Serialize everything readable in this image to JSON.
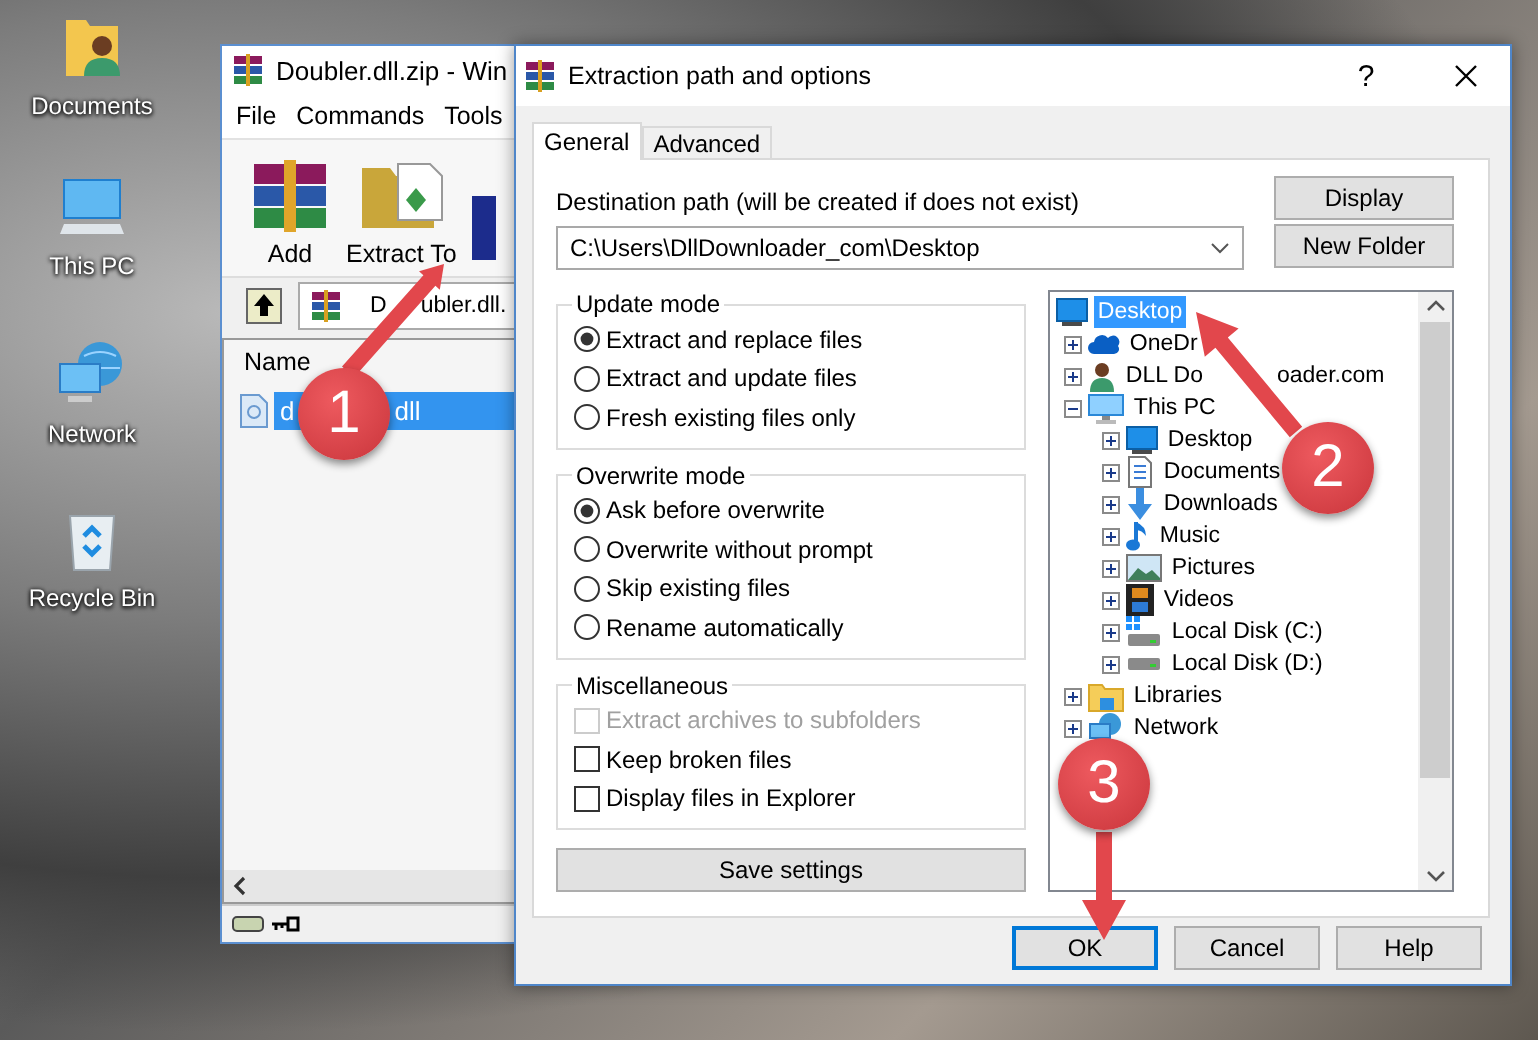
{
  "desktop_icons": [
    {
      "label": "Documents",
      "kind": "user-folder"
    },
    {
      "label": "This PC",
      "kind": "computer"
    },
    {
      "label": "Network",
      "kind": "network"
    },
    {
      "label": "Recycle Bin",
      "kind": "recycle"
    }
  ],
  "archiver_window": {
    "title": "Doubler.dll.zip - Win",
    "menu": [
      "File",
      "Commands",
      "Tools"
    ],
    "toolbar": [
      {
        "label": "Add",
        "kind": "archive"
      },
      {
        "label": "Extract To",
        "kind": "extract"
      },
      {
        "kind": "book"
      }
    ],
    "address_parts": [
      "D",
      "ubler.dll."
    ],
    "column": "Name",
    "files": [
      {
        "name_parts": [
          "d",
          "dll"
        ],
        "selected": true
      }
    ]
  },
  "dialog": {
    "title": "Extraction path and options",
    "help_button": "?",
    "tabs": [
      {
        "label": "General",
        "selected": true
      },
      {
        "label": "Advanced",
        "selected": false
      }
    ],
    "destination_label": "Destination path (will be created if does not exist)",
    "destination_value": "C:\\Users\\DllDownloader_com\\Desktop",
    "side_buttons": [
      "Display",
      "New Folder"
    ],
    "groups": [
      {
        "title": "Update mode",
        "kind": "radio",
        "options": [
          {
            "label": "Extract and replace files",
            "selected": true
          },
          {
            "label": "Extract and update files",
            "selected": false
          },
          {
            "label": "Fresh existing files only",
            "selected": false
          }
        ]
      },
      {
        "title": "Overwrite mode",
        "kind": "radio",
        "options": [
          {
            "label": "Ask before overwrite",
            "selected": true
          },
          {
            "label": "Overwrite without prompt",
            "selected": false
          },
          {
            "label": "Skip existing files",
            "selected": false
          },
          {
            "label": "Rename automatically",
            "selected": false
          }
        ]
      },
      {
        "title": "Miscellaneous",
        "kind": "checkbox",
        "options": [
          {
            "label": "Extract archives to subfolders",
            "checked": false,
            "disabled": true
          },
          {
            "label": "Keep broken files",
            "checked": false,
            "disabled": false
          },
          {
            "label": "Display files in Explorer",
            "checked": false,
            "disabled": false
          }
        ]
      }
    ],
    "save_button": "Save settings",
    "folder_tree": [
      {
        "label": "Desktop",
        "kind": "desktop",
        "selected": true,
        "children": [
          {
            "label": "OneDr",
            "kind": "cloud",
            "expanded": false,
            "selected": false
          },
          {
            "label": "DLL Do",
            "label_tail": "oader.com",
            "kind": "user",
            "expanded": false,
            "selected": false
          },
          {
            "label": "This PC",
            "kind": "computer",
            "expanded": true,
            "selected": false,
            "children": [
              {
                "label": "Desktop",
                "kind": "desktop",
                "expanded": false,
                "selected": false
              },
              {
                "label": "Documents",
                "kind": "document",
                "expanded": false,
                "selected": false
              },
              {
                "label": "Downloads",
                "kind": "download",
                "expanded": false,
                "selected": false
              },
              {
                "label": "Music",
                "kind": "music",
                "expanded": false,
                "selected": false
              },
              {
                "label": "Pictures",
                "kind": "picture",
                "expanded": false,
                "selected": false
              },
              {
                "label": "Videos",
                "kind": "video",
                "expanded": false,
                "selected": false
              },
              {
                "label": "Local Disk (C:)",
                "kind": "system-drive",
                "expanded": false,
                "selected": false
              },
              {
                "label": "Local Disk (D:)",
                "kind": "drive",
                "expanded": false,
                "selected": false
              }
            ]
          },
          {
            "label": "Libraries",
            "kind": "library",
            "expanded": false,
            "selected": false
          },
          {
            "label": "Network",
            "kind": "network",
            "expanded": false,
            "selected": false
          }
        ]
      }
    ],
    "buttons": [
      {
        "label": "OK",
        "default": true
      },
      {
        "label": "Cancel",
        "default": false
      },
      {
        "label": "Help",
        "default": false
      }
    ]
  },
  "annotations": [
    {
      "number": "1"
    },
    {
      "number": "2"
    },
    {
      "number": "3"
    }
  ]
}
